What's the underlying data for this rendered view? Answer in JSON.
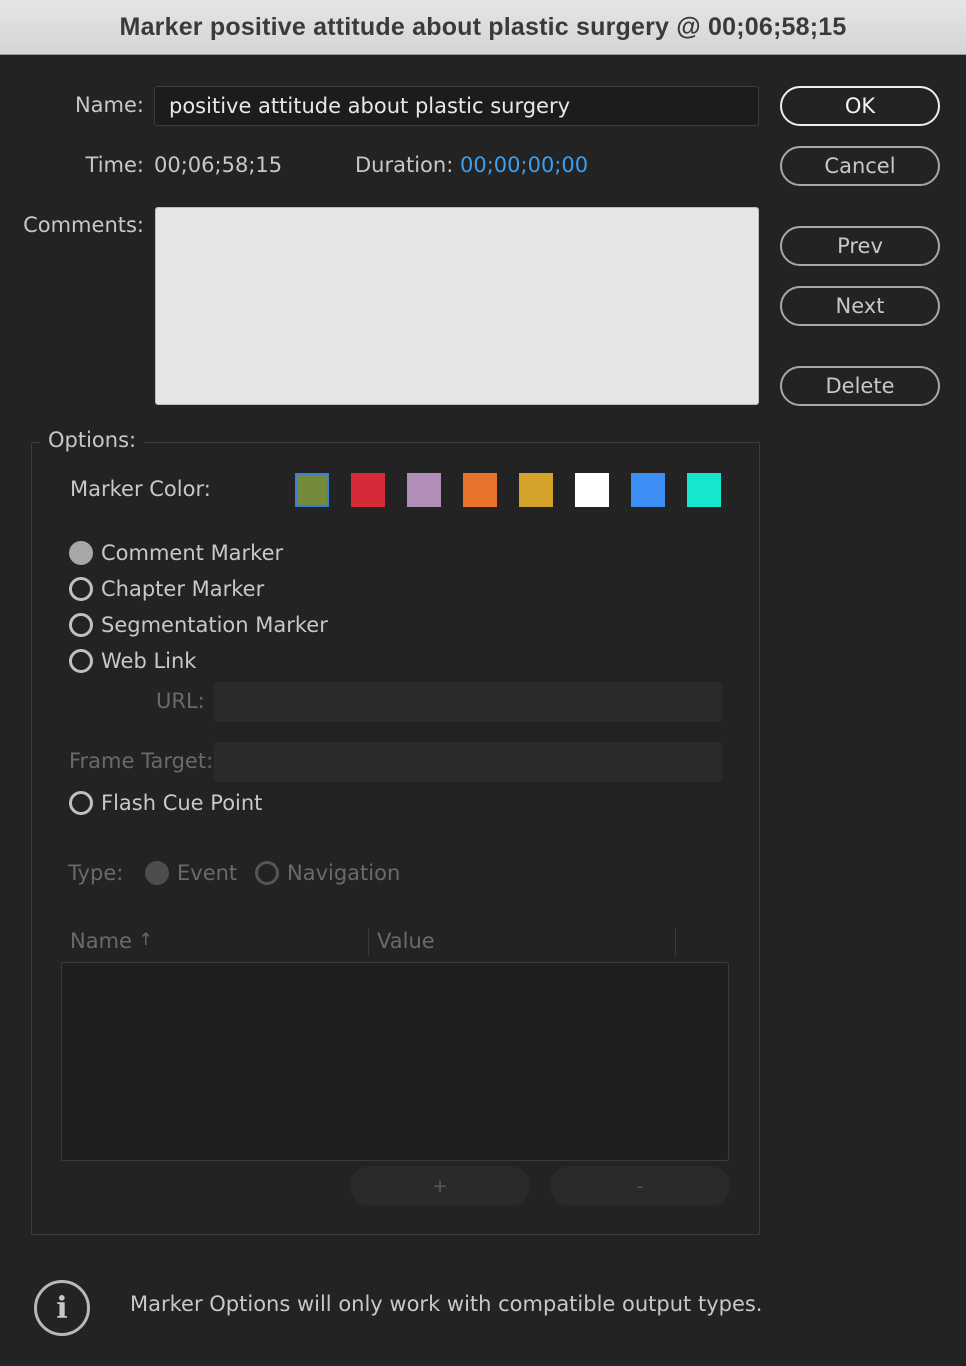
{
  "window": {
    "title": "Marker positive attitude about plastic surgery @ 00;06;58;15"
  },
  "form": {
    "name_label": "Name:",
    "name_value": "positive attitude about plastic surgery",
    "time_label": "Time:",
    "time_value": "00;06;58;15",
    "duration_label": "Duration:",
    "duration_value": "00;00;00;00",
    "comments_label": "Comments:"
  },
  "buttons": {
    "ok": "OK",
    "cancel": "Cancel",
    "prev": "Prev",
    "next": "Next",
    "delete": "Delete"
  },
  "options": {
    "legend": "Options:",
    "marker_color_label": "Marker Color:",
    "colors": [
      "#738a3a",
      "#d52a37",
      "#b08eb8",
      "#e8732a",
      "#d4a22a",
      "#ffffff",
      "#3d8ff5",
      "#16e5cf"
    ],
    "selected_color_index": 0,
    "marker_types": [
      "Comment Marker",
      "Chapter Marker",
      "Segmentation Marker",
      "Web Link"
    ],
    "selected_marker_type": "Comment Marker",
    "url_label": "URL:",
    "frame_target_label": "Frame Target:",
    "flash_cue_point": "Flash Cue Point",
    "type_label": "Type:",
    "type_event": "Event",
    "type_navigation": "Navigation",
    "table_headers": [
      "Name",
      "Value"
    ],
    "add_label": "+",
    "remove_label": "-"
  },
  "footer": {
    "info_text": "Marker Options will only work with compatible output types."
  }
}
